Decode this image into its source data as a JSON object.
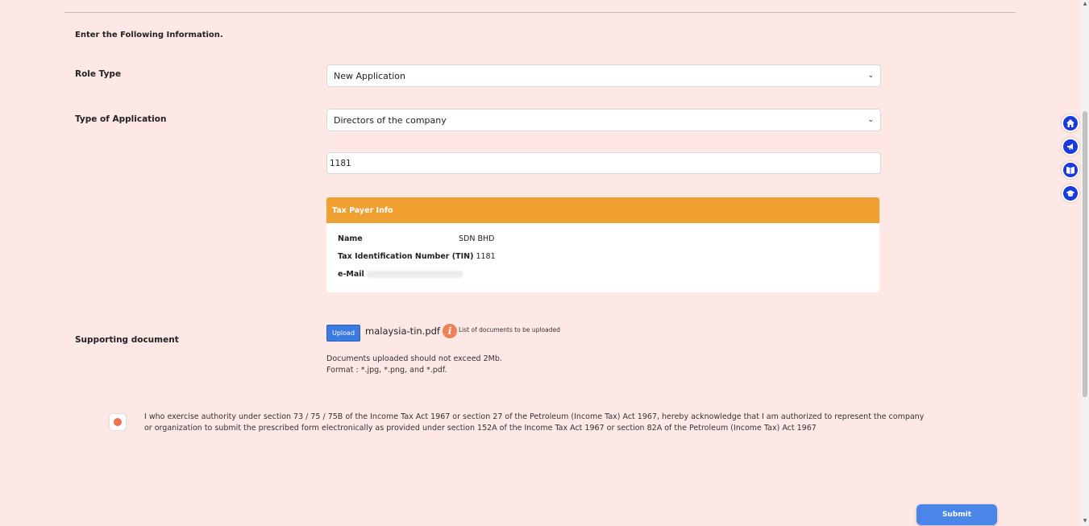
{
  "form": {
    "heading": "Enter the Following Information.",
    "role_type_label": "Role Type",
    "role_type_value": "New Application",
    "application_type_label": "Type of Application",
    "application_type_value": "Directors of the company",
    "tin_input_value": "1181"
  },
  "taxpayer": {
    "header": "Tax Payer Info",
    "name_label": "Name",
    "name_value": "SDN BHD",
    "tin_label": "Tax Identification Number (TIN)",
    "tin_value": "1181",
    "email_label": "e-Mail",
    "email_value": ""
  },
  "documents": {
    "label": "Supporting document",
    "upload_label": "Upload",
    "filename": "malaysia-tin.pdf",
    "list_link": "List of documents to be uploaded",
    "note_size": "Documents uploaded should not exceed 2Mb.",
    "note_format": "Format : *.jpg, *.png, and *.pdf."
  },
  "acknowledgement": {
    "text": "I who exercise authority under section 73 / 75 / 75B of the Income Tax Act 1967 or section 27 of the Petroleum (Income Tax) Act 1967, hereby acknowledge that I am authorized to represent the company or organization to submit the prescribed form electronically as provided under section 152A of the Income Tax Act 1967 or section 82A of the Petroleum (Income Tax) Act 1967"
  },
  "actions": {
    "submit_label": "Submit"
  },
  "side_nav": [
    {
      "icon": "home-icon"
    },
    {
      "icon": "megaphone-icon"
    },
    {
      "icon": "book-icon"
    },
    {
      "icon": "graduation-cap-icon"
    }
  ],
  "colors": {
    "background": "#fde8e6",
    "card_header": "#f0a030",
    "primary": "#4a86ea",
    "side_nav": "#1a3ae0"
  }
}
